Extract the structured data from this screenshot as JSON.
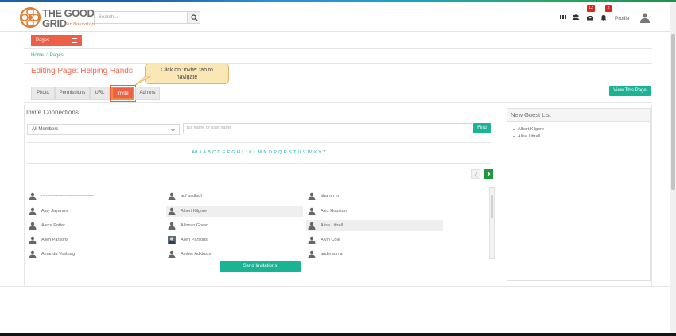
{
  "brand": {
    "line1": "THE GOOD",
    "line2": "GRID",
    "tagline": "for Roundtop"
  },
  "header": {
    "search_placeholder": "Search...",
    "messages_count": "12",
    "notifications_count": "2",
    "profile_label": "Profile"
  },
  "nav": {
    "pages_label": "Pages"
  },
  "breadcrumb": {
    "home": "Home",
    "separator": "/",
    "current": "Pages"
  },
  "page_title": "Editing Page: Helping Hands",
  "callout": {
    "line1": "Click on 'Invite' tab to",
    "line2": "navigate"
  },
  "tabs": [
    {
      "label": "Photo"
    },
    {
      "label": "Permissions"
    },
    {
      "label": "URL"
    },
    {
      "label": "Invite",
      "active": true
    },
    {
      "label": "Admins"
    }
  ],
  "view_page_button": "View This Page",
  "invite": {
    "title": "Invite Connections",
    "members_select": "All Members",
    "name_placeholder": "full name or user name",
    "find_button": "Find",
    "alphabet": "All # A B C D E F G H I J K L M N O P Q R S T U V W X Y Z",
    "send_button": "Send Invitations",
    "members": [
      [
        "------------------------------------",
        "adf asdfsdf",
        "aharon m"
      ],
      [
        "Ajay Jayaram",
        "Albert Kilgore",
        "Alex Houston"
      ],
      [
        "Alexa Potter",
        "Alfonzo Green",
        "Alisa Littrell"
      ],
      [
        "Allen Parsons",
        "Allen Parsons",
        "Alvin Cole"
      ],
      [
        "Amanda Vosburg",
        "Amber Adkinson",
        "anderson a"
      ]
    ]
  },
  "guest_list": {
    "title": "New Guest List",
    "items": [
      "Albert Kilgore",
      "Alisa Littrell"
    ]
  },
  "colors": {
    "accent": "#ef5f48",
    "teal": "#1ab394",
    "green": "#1c9a3d",
    "badge": "#e0251c"
  }
}
